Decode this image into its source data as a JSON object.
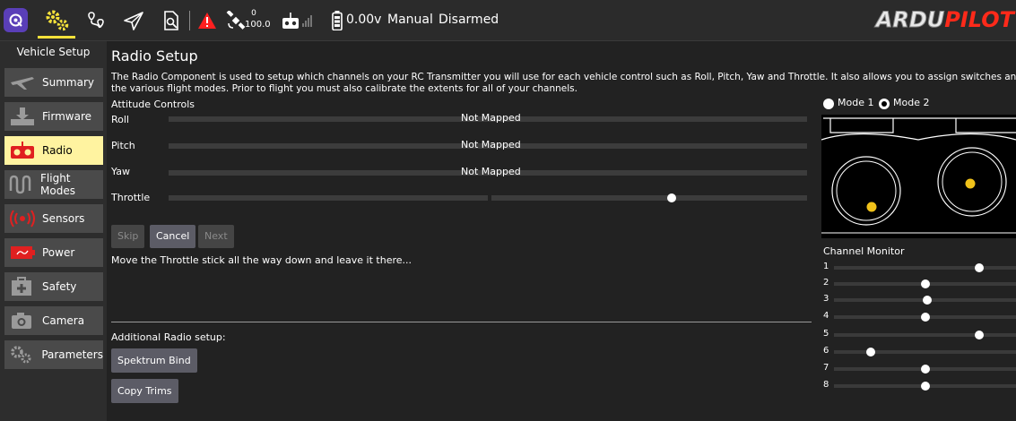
{
  "toolbar": {
    "battery_voltage": "0.00v",
    "flight_mode": "Manual",
    "arm_state": "Disarmed",
    "gps_count": "0",
    "gps_hdop": "100.0",
    "brand": "ARDUPILOT",
    "brand_part1": "ARDU",
    "brand_part2": "PILOT",
    "accent_color": "#f4e13a",
    "warning_color": "#ff2020"
  },
  "sidebar": {
    "title": "Vehicle Setup",
    "items": [
      {
        "label": "Summary",
        "icon": "plane-icon"
      },
      {
        "label": "Firmware",
        "icon": "download-icon"
      },
      {
        "label": "Radio",
        "icon": "radio-icon",
        "active": true
      },
      {
        "label": "Flight Modes",
        "icon": "flight-modes-icon"
      },
      {
        "label": "Sensors",
        "icon": "sensors-icon"
      },
      {
        "label": "Power",
        "icon": "battery-icon"
      },
      {
        "label": "Safety",
        "icon": "safety-icon"
      },
      {
        "label": "Camera",
        "icon": "camera-icon"
      },
      {
        "label": "Parameters",
        "icon": "gears-icon"
      }
    ]
  },
  "main": {
    "title": "Radio Setup",
    "description_line1": "The Radio Component is used to setup which channels on your RC Transmitter you will use for each vehicle control such as Roll, Pitch, Yaw and Throttle. It also allows you to assign switches and dials to",
    "description_line2": "the various flight modes. Prior to flight you must also calibrate the extents for all of your channels.",
    "attitude_title": "Attitude Controls",
    "controls": [
      {
        "label": "Roll",
        "status": "Not Mapped"
      },
      {
        "label": "Pitch",
        "status": "Not Mapped"
      },
      {
        "label": "Yaw",
        "status": "Not Mapped"
      },
      {
        "label": "Throttle",
        "status": ""
      }
    ],
    "buttons": {
      "skip": "Skip",
      "cancel": "Cancel",
      "next": "Next"
    },
    "instruction": "Move the Throttle stick all the way down and leave it there...",
    "additional_title": "Additional Radio setup:",
    "spektrum_bind": "Spektrum Bind",
    "copy_trims": "Copy Trims"
  },
  "right_panel": {
    "mode1_label": "Mode 1",
    "mode2_label": "Mode 2",
    "selected_mode": "Mode 2",
    "channel_monitor_title": "Channel Monitor",
    "channels": [
      {
        "label": "1",
        "level": 0.8
      },
      {
        "label": "2",
        "level": 0.5
      },
      {
        "label": "3",
        "level": 0.51
      },
      {
        "label": "4",
        "level": 0.5
      },
      {
        "label": "5",
        "level": 0.8
      },
      {
        "label": "6",
        "level": 0.2
      },
      {
        "label": "7",
        "level": 0.5
      },
      {
        "label": "8",
        "level": 0.5
      }
    ]
  }
}
